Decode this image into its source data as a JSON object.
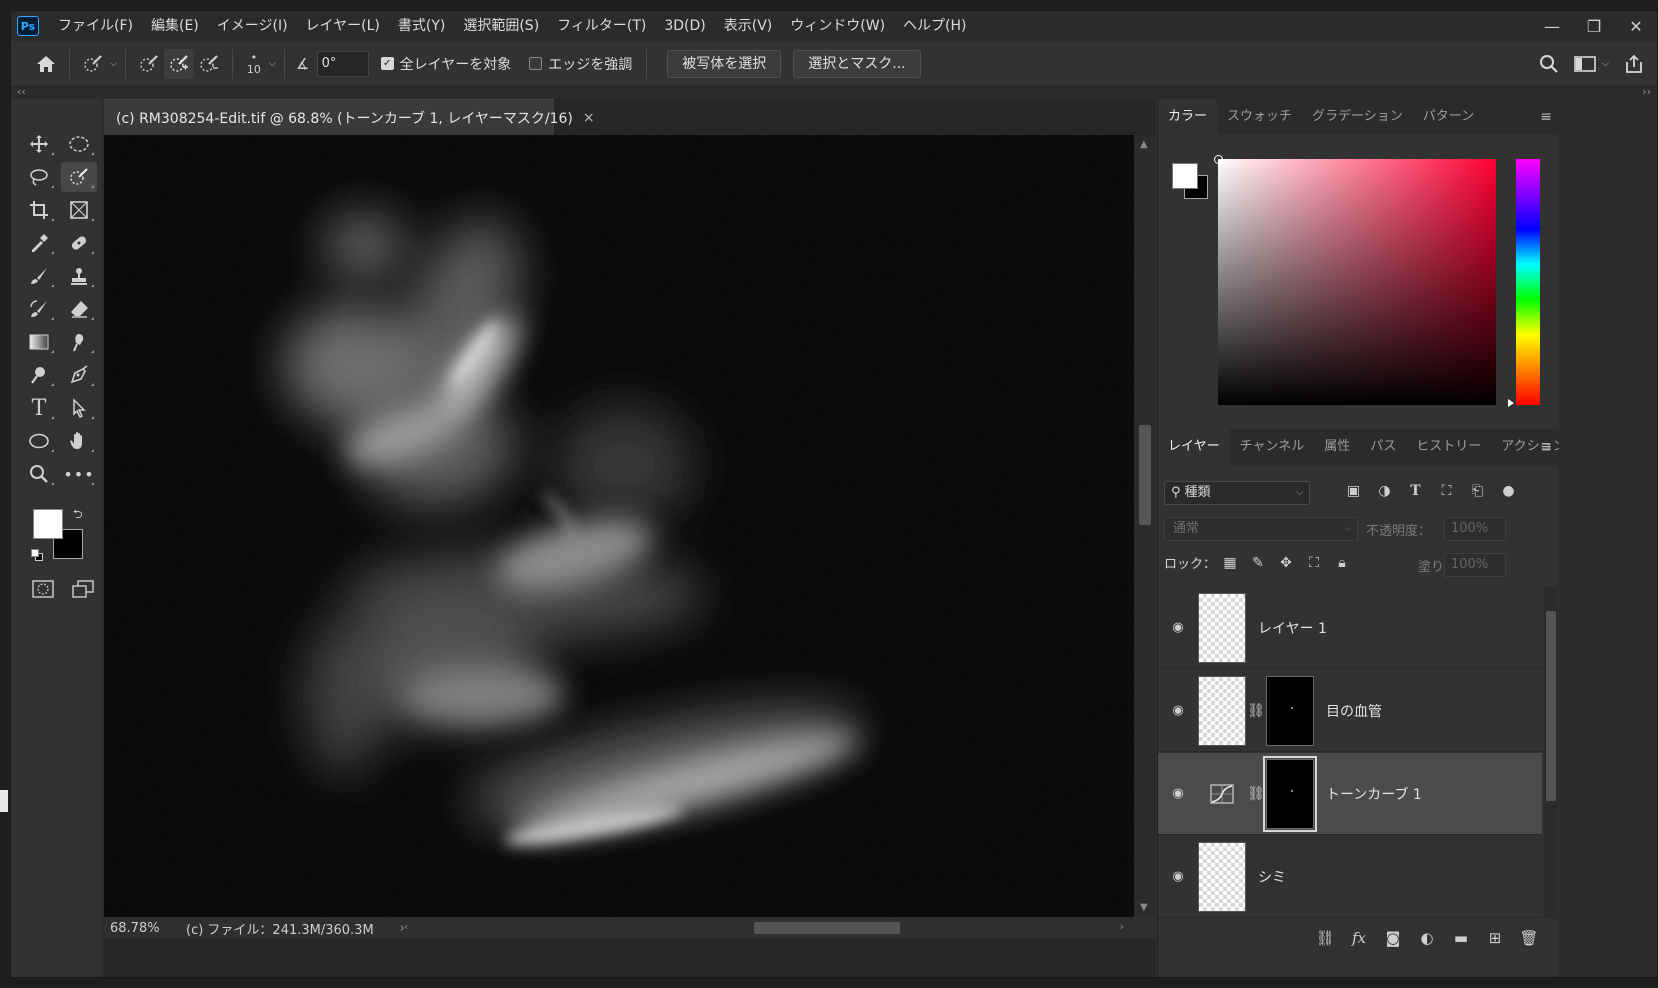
{
  "menubar": {
    "logo": "Ps",
    "items": [
      "ファイル(F)",
      "編集(E)",
      "イメージ(I)",
      "レイヤー(L)",
      "書式(Y)",
      "選択範囲(S)",
      "フィルター(T)",
      "3D(D)",
      "表示(V)",
      "ウィンドウ(W)",
      "ヘルプ(H)"
    ]
  },
  "options": {
    "brush_size": "10",
    "angle": "0°",
    "sample_all_layers": "全レイヤーを対象",
    "enhance_edge": "エッジを強調",
    "select_subject": "被写体を選択",
    "select_and_mask": "選択とマスク..."
  },
  "document": {
    "tab_title": "(c) RM308254-Edit.tif @ 68.8% (トーンカーブ 1, レイヤーマスク/16)",
    "zoom": "68.78%",
    "file_info": "(c) ファイル：241.3M/360.3M"
  },
  "color_panel": {
    "tabs": [
      "カラー",
      "スウォッチ",
      "グラデーション",
      "パターン"
    ],
    "fg_color": "#ffffff",
    "bg_color": "#000000"
  },
  "layers_panel": {
    "tabs": [
      "レイヤー",
      "チャンネル",
      "属性",
      "パス",
      "ヒストリー",
      "アクション"
    ],
    "filter_label": "種類",
    "blend_mode": "通常",
    "opacity_label": "不透明度：",
    "opacity_value": "100%",
    "lock_label": "ロック：",
    "fill_label": "塗り：",
    "fill_value": "100%",
    "layers": [
      {
        "name": "レイヤー 1",
        "type": "pixel",
        "selected": false
      },
      {
        "name": "目の血管",
        "type": "pixel-mask",
        "selected": false
      },
      {
        "name": "トーンカーブ 1",
        "type": "adjustment",
        "selected": true
      },
      {
        "name": "シミ",
        "type": "pixel",
        "selected": false
      }
    ]
  }
}
